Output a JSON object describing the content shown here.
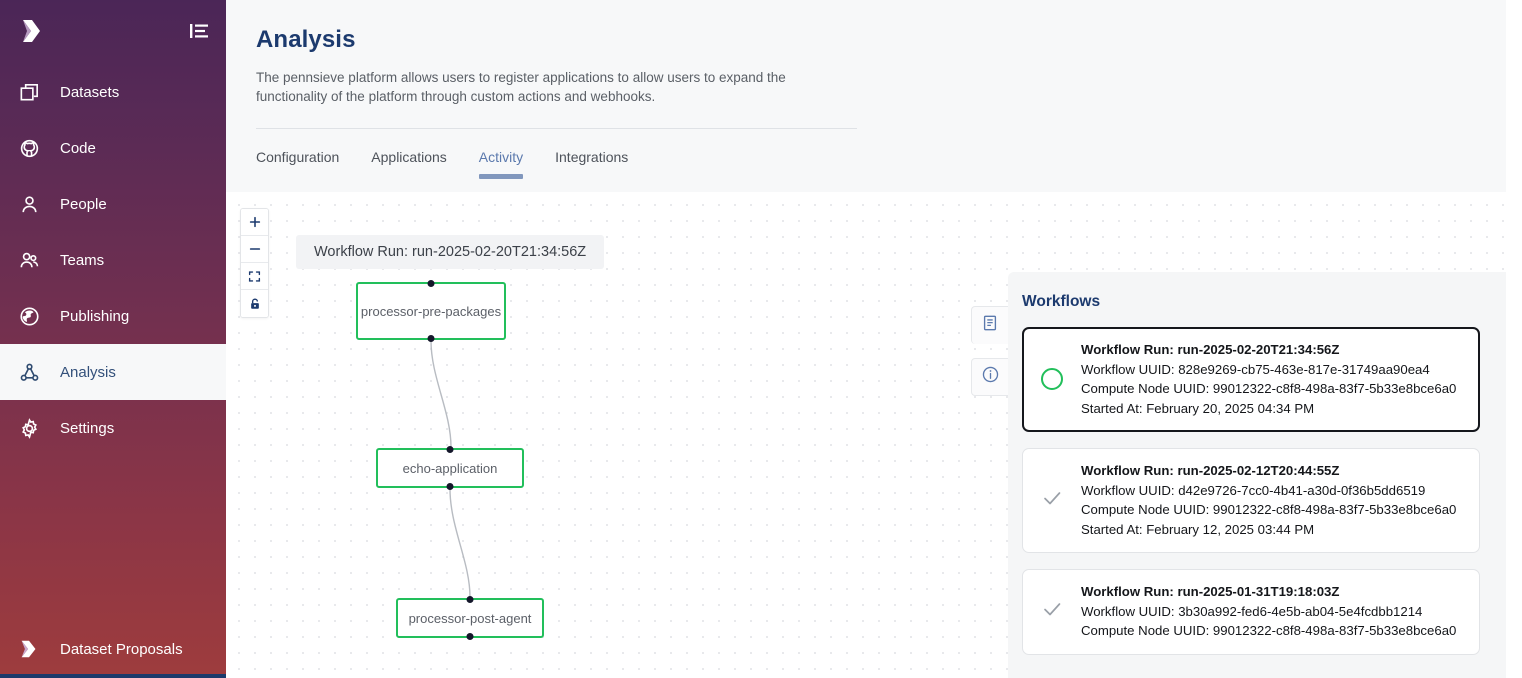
{
  "sidebar": {
    "brand_icon": "pennsieve-logo-icon",
    "collapse_icon": "collapse-sidebar-icon",
    "items": [
      {
        "label": "Datasets",
        "icon": "datasets-icon",
        "active": false
      },
      {
        "label": "Code",
        "icon": "github-code-icon",
        "active": false
      },
      {
        "label": "People",
        "icon": "person-icon",
        "active": false
      },
      {
        "label": "Teams",
        "icon": "teams-icon",
        "active": false
      },
      {
        "label": "Publishing",
        "icon": "globe-publishing-icon",
        "active": false
      },
      {
        "label": "Analysis",
        "icon": "analysis-graph-icon",
        "active": true
      },
      {
        "label": "Settings",
        "icon": "gear-icon",
        "active": false
      }
    ],
    "bottom_item": {
      "label": "Dataset Proposals",
      "icon": "pennsieve-logo-icon"
    }
  },
  "header": {
    "title": "Analysis",
    "description": "The pennsieve platform allows users to register applications to allow users to expand the functionality of the platform through custom actions and webhooks.",
    "tabs": [
      {
        "label": "Configuration",
        "active": false
      },
      {
        "label": "Applications",
        "active": false
      },
      {
        "label": "Activity",
        "active": true
      },
      {
        "label": "Integrations",
        "active": false
      }
    ]
  },
  "canvas": {
    "zoom_controls": [
      {
        "name": "zoom-in",
        "glyph": "+"
      },
      {
        "name": "zoom-out",
        "glyph": "−"
      },
      {
        "name": "fit-view",
        "glyph": "fit"
      },
      {
        "name": "lock",
        "glyph": "lock"
      }
    ],
    "run_label": "Workflow Run: run-2025-02-20T21:34:56Z",
    "node_border_color": "#22bf5b",
    "nodes": [
      {
        "label": "processor-pre-packages"
      },
      {
        "label": "echo-application"
      },
      {
        "label": "processor-post-agent"
      }
    ],
    "side_buttons": [
      {
        "name": "logs-panel-button",
        "icon": "document-log-icon"
      },
      {
        "name": "info-panel-button",
        "icon": "info-circle-icon"
      }
    ]
  },
  "workflows": {
    "title": "Workflows",
    "accent_running_color": "#22bf5b",
    "cards": [
      {
        "run": "Workflow Run: run-2025-02-20T21:34:56Z",
        "workflow_uuid": "Workflow UUID: 828e9269-cb75-463e-817e-31749aa90ea4",
        "compute_node_uuid": "Compute Node UUID: 99012322-c8f8-498a-83f7-5b33e8bce6a0",
        "started_at": "Started At: February 20, 2025 04:34 PM",
        "status": "running",
        "selected": true
      },
      {
        "run": "Workflow Run: run-2025-02-12T20:44:55Z",
        "workflow_uuid": "Workflow UUID: d42e9726-7cc0-4b41-a30d-0f36b5dd6519",
        "compute_node_uuid": "Compute Node UUID: 99012322-c8f8-498a-83f7-5b33e8bce6a0",
        "started_at": "Started At: February 12, 2025 03:44 PM",
        "status": "complete",
        "selected": false
      },
      {
        "run": "Workflow Run: run-2025-01-31T19:18:03Z",
        "workflow_uuid": "Workflow UUID: 3b30a992-fed6-4e5b-ab04-5e4fcdbb1214",
        "compute_node_uuid": "Compute Node UUID: 99012322-c8f8-498a-83f7-5b33e8bce6a0",
        "started_at": "",
        "status": "complete",
        "selected": false
      }
    ]
  }
}
